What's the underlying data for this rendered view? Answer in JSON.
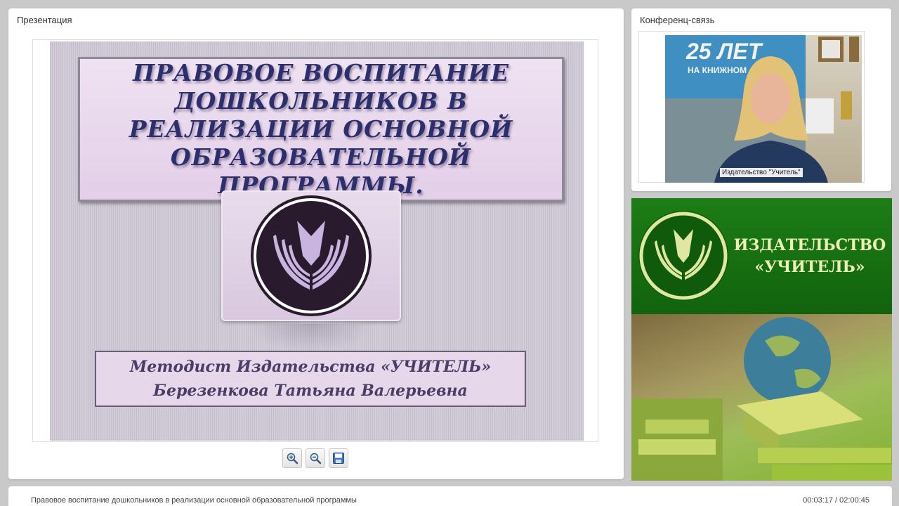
{
  "presentation": {
    "panel_title": "Презентация",
    "slide": {
      "title": "Правовое воспитание дошкольников в реализации основной образовательной программы.",
      "author_line1": "Методист Издательства «УЧИТЕЛЬ»",
      "author_line2": "Березенкова  Татьяна Валерьевна"
    },
    "toolbar": [
      {
        "name": "zoom-in",
        "icon": "zoom-in-icon"
      },
      {
        "name": "zoom-out",
        "icon": "zoom-out-icon"
      },
      {
        "name": "save",
        "icon": "save-icon"
      }
    ]
  },
  "conference": {
    "panel_title": "Конференц-связь",
    "video_label": "Издательство \"Учитель\"",
    "poster_text_top": "25 ЛЕТ",
    "poster_text_sub": "НА КНИЖНОМ"
  },
  "banner": {
    "line1": "ИЗДАТЕЛЬСТВО",
    "line2": "«УЧИТЕЛЬ»"
  },
  "footer": {
    "title": "Правовое воспитание дошкольников в реализации основной образовательной программы",
    "time": "00:03:17 / 02:00:45"
  },
  "colors": {
    "slide_title": "#2b2f6d",
    "banner_green": "#1d7d16",
    "banner_text": "#eeefb8"
  }
}
